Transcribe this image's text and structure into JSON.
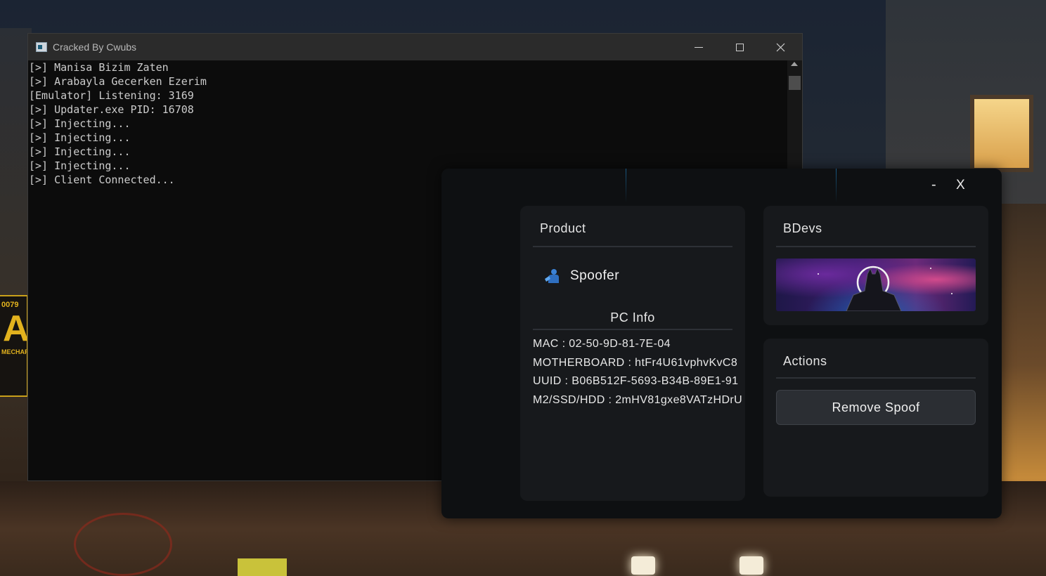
{
  "background": {
    "sign_number": "0079",
    "sign_letter": "A",
    "sign_text": "MECHAFI"
  },
  "console": {
    "title": "Cracked By Cwubs",
    "lines": [
      "[>] Manisa Bizim Zaten",
      "[>] Arabayla Gecerken Ezerim",
      "[Emulator] Listening: 3169",
      "[>] Updater.exe PID: 16708",
      "[>] Injecting...",
      "[>] Injecting...",
      "[>] Injecting...",
      "[>] Injecting...",
      "[>] Client Connected..."
    ],
    "controls": {
      "minimize_icon": "minimize-icon",
      "maximize_icon": "maximize-icon",
      "close_icon": "close-icon"
    }
  },
  "app": {
    "minimize_label": "-",
    "close_label": "X",
    "product": {
      "title": "Product",
      "item_label": "Spoofer",
      "item_icon": "user-spoof-icon"
    },
    "pc_info": {
      "title": "PC Info",
      "rows": [
        "MAC : 02-50-9D-81-7E-04",
        "MOTHERBOARD : htFr4U61vphvKvC8",
        "UUID : B06B512F-5693-B34B-89E1-91",
        "M2/SSD/HDD : 2mHV81gxe8VATzHDrU"
      ]
    },
    "bdevs": {
      "title": "BDevs",
      "banner_icon": "batman-banner-image"
    },
    "actions": {
      "title": "Actions",
      "remove_label": "Remove Spoof"
    },
    "colors": {
      "panel": "#17191c",
      "bg": "#0e1012",
      "accent": "#1a5d88",
      "button": "#2b2e33"
    }
  }
}
